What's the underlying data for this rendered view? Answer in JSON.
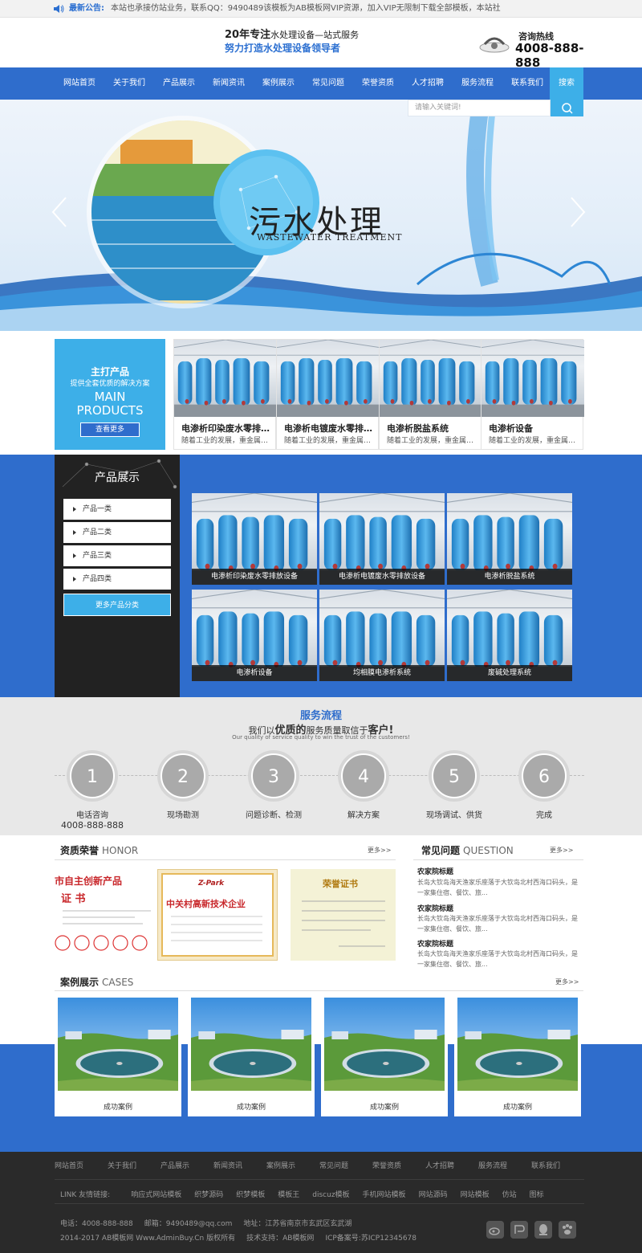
{
  "notice": {
    "label": "最新公告:",
    "text": "本站也承接仿站业务，联系QQ：9490489该模板为AB模板网VIP资源，加入VIP无限制下载全部模板，本站社"
  },
  "header": {
    "slogan_big": "20年专注",
    "slogan_rest": "水处理设备—站式服务",
    "slogan_sub": "努力打造水处理设备领导者",
    "hotline_label": "咨询热线",
    "hotline_number": "4008-888-888"
  },
  "nav": {
    "items": [
      "网站首页",
      "关于我们",
      "产品展示",
      "新闻资讯",
      "案例展示",
      "常见问题",
      "荣誉资质",
      "人才招聘",
      "服务流程",
      "联系我们"
    ],
    "search_label": "搜索"
  },
  "banner": {
    "search_placeholder": "请输入关键词!",
    "title_cn": "污水处理",
    "title_en": "WASTEWATER TREATMENT"
  },
  "main_products": {
    "title": "主打产品",
    "subtitle": "提供全套优质的解决方案",
    "en1": "MAIN",
    "en2": "PRODUCTS",
    "more": "查看更多",
    "items": [
      {
        "title": "电渗析印染废水零排放设备",
        "desc": "随着工业的发展，重金属废水处理"
      },
      {
        "title": "电渗析电镀废水零排放设备",
        "desc": "随着工业的发展，重金属废水处理"
      },
      {
        "title": "电渗析脱盐系统",
        "desc": "随着工业的发展，重金属废水处理"
      },
      {
        "title": "电渗析设备",
        "desc": "随着工业的发展，重金属废水处理"
      }
    ]
  },
  "products": {
    "title": "产品展示",
    "categories": [
      "产品一类",
      "产品二类",
      "产品三类",
      "产品四类"
    ],
    "more": "更多产品分类",
    "items": [
      "电渗析印染废水零排放设备",
      "电渗析电镀废水零排放设备",
      "电渗析脱盐系统",
      "电渗析设备",
      "均相膜电渗析系统",
      "废碱处理系统"
    ]
  },
  "service": {
    "title": "服务流程",
    "tag_pre": "我们以",
    "tag_b1": "优质的",
    "tag_mid": "服务质量取信于",
    "tag_b2": "客户!",
    "tag_en": "Our quality of service quality to win the trust of the customers!",
    "steps": [
      {
        "num": "1",
        "label": "电话咨询",
        "phone": "4008-888-888"
      },
      {
        "num": "2",
        "label": "现场勘测"
      },
      {
        "num": "3",
        "label": "问题诊断、检测"
      },
      {
        "num": "4",
        "label": "解决方案"
      },
      {
        "num": "5",
        "label": "现场调试、供货"
      },
      {
        "num": "6",
        "label": "完成"
      }
    ]
  },
  "honor": {
    "title": "资质荣誉",
    "en": "HONOR",
    "more": "更多>>",
    "cert1_a": "市自主创新产品",
    "cert1_b": "证 书",
    "cert2_logo": "Z-Park",
    "cert2_a": "中关村高新技术企业",
    "cert3_a": "荣誉证书"
  },
  "faq": {
    "title": "常见问题",
    "en": "QUESTION",
    "more": "更多>>",
    "items": [
      {
        "q": "农家院标题",
        "a": "长岛大钦岛海天渔家乐座落于大钦岛北村西海口码头，是一家集住宿、餐饮、旅..."
      },
      {
        "q": "农家院标题",
        "a": "长岛大钦岛海天渔家乐座落于大钦岛北村西海口码头，是一家集住宿、餐饮、旅..."
      },
      {
        "q": "农家院标题",
        "a": "长岛大钦岛海天渔家乐座落于大钦岛北村西海口码头，是一家集住宿、餐饮、旅..."
      }
    ]
  },
  "cases": {
    "title": "案例展示",
    "en": "CASES",
    "more": "更多>>",
    "items": [
      "成功案例",
      "成功案例",
      "成功案例",
      "成功案例"
    ]
  },
  "footer": {
    "nav": [
      "网站首页",
      "关于我们",
      "产品展示",
      "新闻资讯",
      "案例展示",
      "常见问题",
      "荣誉资质",
      "人才招聘",
      "服务流程",
      "联系我们"
    ],
    "links_label": "LINK 友情链接:",
    "links": [
      "响应式网站模板",
      "织梦源码",
      "织梦模板",
      "模板王",
      "discuz模板",
      "手机网站模板",
      "网站源码",
      "网站模板",
      "仿站",
      "图标"
    ],
    "phone": "电话：4008-888-888",
    "email": "邮箱：9490489@qq.com",
    "address": "地址：江苏省南京市玄武区玄武湖",
    "copyright": "2014-2017 AB模板网 Www.AdminBuy.Cn 版权所有",
    "support": "技术支持：AB模板网",
    "icp": "ICP备案号:苏ICP12345678"
  }
}
